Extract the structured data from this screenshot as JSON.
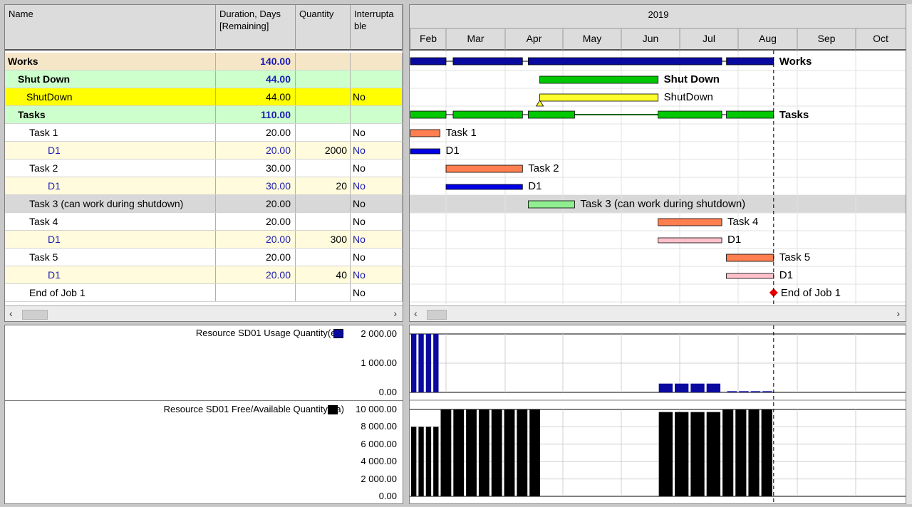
{
  "columns": {
    "name": "Name",
    "duration": "Duration, Days [Remaining]",
    "quantity": "Quantity",
    "interruptable": "Interruptable"
  },
  "rows": [
    {
      "name": "Works",
      "duration": "140.00",
      "quantity": "",
      "interruptable": "",
      "style": "summary",
      "bg": "#f5e6c8",
      "indent": 0
    },
    {
      "name": "Shut Down",
      "duration": "44.00",
      "quantity": "",
      "interruptable": "",
      "style": "group",
      "bg": "#ccffcc",
      "indent": 14
    },
    {
      "name": "ShutDown",
      "duration": "44.00",
      "quantity": "",
      "interruptable": "No",
      "style": "selected",
      "bg": "#ffff00",
      "indent": 26
    },
    {
      "name": "Tasks",
      "duration": "110.00",
      "quantity": "",
      "interruptable": "",
      "style": "group",
      "bg": "#ccffcc",
      "indent": 14
    },
    {
      "name": "Task 1",
      "duration": "20.00",
      "quantity": "",
      "interruptable": "No",
      "style": "task",
      "bg": "#ffffff",
      "indent": 30
    },
    {
      "name": "D1",
      "duration": "20.00",
      "quantity": "2000",
      "interruptable": "No",
      "style": "demand",
      "bg": "#fffbdc",
      "indent": 56
    },
    {
      "name": "Task 2",
      "duration": "30.00",
      "quantity": "",
      "interruptable": "No",
      "style": "task",
      "bg": "#ffffff",
      "indent": 30
    },
    {
      "name": "D1",
      "duration": "30.00",
      "quantity": "20",
      "interruptable": "No",
      "style": "demand",
      "bg": "#fffbdc",
      "indent": 56
    },
    {
      "name": "Task 3 (can work during shutdown)",
      "duration": "20.00",
      "quantity": "",
      "interruptable": "No",
      "style": "task",
      "bg": "#d8d8d8",
      "indent": 30
    },
    {
      "name": "Task 4",
      "duration": "20.00",
      "quantity": "",
      "interruptable": "No",
      "style": "task",
      "bg": "#ffffff",
      "indent": 30
    },
    {
      "name": "D1",
      "duration": "20.00",
      "quantity": "300",
      "interruptable": "No",
      "style": "demand",
      "bg": "#fffbdc",
      "indent": 56
    },
    {
      "name": "Task 5",
      "duration": "20.00",
      "quantity": "",
      "interruptable": "No",
      "style": "task",
      "bg": "#ffffff",
      "indent": 30
    },
    {
      "name": "D1",
      "duration": "20.00",
      "quantity": "40",
      "interruptable": "No",
      "style": "demand",
      "bg": "#fffbdc",
      "indent": 56
    },
    {
      "name": "End of Job 1",
      "duration": "",
      "quantity": "",
      "interruptable": "No",
      "style": "task",
      "bg": "#ffffff",
      "indent": 30
    }
  ],
  "timeline": {
    "year": "2019",
    "months": [
      "Feb",
      "Mar",
      "Apr",
      "May",
      "Jun",
      "Jul",
      "Aug",
      "Sep",
      "Oct"
    ]
  },
  "bars": [
    {
      "row": 0,
      "label": "Works",
      "segments": [
        [
          0,
          1.0
        ],
        [
          1.12,
          2.3
        ],
        [
          2.4,
          5.72
        ],
        [
          5.8,
          6.6
        ]
      ],
      "color": "#0a0aa0",
      "type": "summary",
      "bold": true
    },
    {
      "row": 1,
      "label": "Shut Down",
      "segments": [
        [
          2.6,
          4.63
        ]
      ],
      "color": "#00c800",
      "type": "task",
      "bold": true
    },
    {
      "row": 2,
      "label": "ShutDown",
      "segments": [
        [
          2.6,
          4.63
        ]
      ],
      "color": "#ffff30",
      "type": "task",
      "bold": false
    },
    {
      "row": 3,
      "label": "Tasks",
      "segments": [
        [
          0,
          1.0
        ],
        [
          1.12,
          2.3
        ],
        [
          2.4,
          3.2
        ],
        [
          4.63,
          5.72
        ],
        [
          5.8,
          6.6
        ]
      ],
      "thin": [
        [
          3.2,
          4.63
        ]
      ],
      "color": "#00c800",
      "type": "summary",
      "bold": true
    },
    {
      "row": 4,
      "label": "Task 1",
      "segments": [
        [
          0,
          0.83
        ]
      ],
      "color": "#ff7f50",
      "type": "task",
      "bold": false
    },
    {
      "row": 5,
      "label": "D1",
      "segments": [
        [
          0,
          0.83
        ]
      ],
      "color": "#0000e6",
      "type": "demand",
      "bold": false
    },
    {
      "row": 6,
      "label": "Task 2",
      "segments": [
        [
          1.0,
          2.3
        ]
      ],
      "color": "#ff7f50",
      "type": "task",
      "bold": false
    },
    {
      "row": 7,
      "label": "D1",
      "segments": [
        [
          1.0,
          2.3
        ]
      ],
      "color": "#0000e6",
      "type": "demand",
      "bold": false
    },
    {
      "row": 8,
      "label": "Task 3 (can work during shutdown)",
      "segments": [
        [
          2.4,
          3.2
        ]
      ],
      "color": "#90ee90",
      "type": "task",
      "bold": false
    },
    {
      "row": 9,
      "label": "Task 4",
      "segments": [
        [
          4.63,
          5.72
        ]
      ],
      "color": "#ff7f50",
      "type": "task",
      "bold": false
    },
    {
      "row": 10,
      "label": "D1",
      "segments": [
        [
          4.63,
          5.72
        ]
      ],
      "color": "#ffc0cb",
      "type": "demand",
      "bold": false
    },
    {
      "row": 11,
      "label": "Task 5",
      "segments": [
        [
          5.8,
          6.6
        ]
      ],
      "color": "#ff7f50",
      "type": "task",
      "bold": false
    },
    {
      "row": 12,
      "label": "D1",
      "segments": [
        [
          5.8,
          6.6
        ]
      ],
      "color": "#ffc0cb",
      "type": "demand",
      "bold": false
    },
    {
      "row": 13,
      "label": "End of Job 1",
      "milestone": 6.6,
      "color": "#e60000",
      "type": "milestone",
      "bold": false
    }
  ],
  "resources": {
    "usage": {
      "label": "Resource SD01 Usage Quantity(ea)",
      "color": "#0a0aa0",
      "ticks": [
        "2 000.00",
        "1 000.00",
        "0.00"
      ],
      "ymax": 2000,
      "values": [
        {
          "from": 0,
          "to": 0.83,
          "value": 2000,
          "bars": 4
        },
        {
          "from": 4.63,
          "to": 5.72,
          "value": 300,
          "bars": 4
        },
        {
          "from": 5.8,
          "to": 6.6,
          "value": 40,
          "bars": 4
        }
      ]
    },
    "available": {
      "label": "Resource SD01 Free/Available Quantity(ea)",
      "color": "#000000",
      "ticks": [
        "10 000.00",
        "8 000.00",
        "6 000.00",
        "4 000.00",
        "2 000.00",
        "0.00"
      ],
      "ymax": 10000,
      "values": [
        {
          "from": 0,
          "to": 0.83,
          "value": 8000,
          "bars": 4
        },
        {
          "from": 0.83,
          "to": 2.63,
          "value": 10000,
          "bars": 8
        },
        {
          "from": 4.63,
          "to": 5.72,
          "value": 9700,
          "bars": 4
        },
        {
          "from": 5.72,
          "to": 6.6,
          "value": 10000,
          "bars": 4
        }
      ]
    }
  }
}
